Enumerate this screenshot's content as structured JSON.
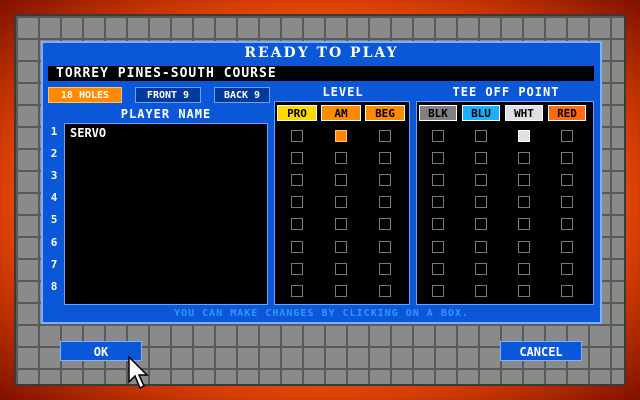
{
  "dialog": {
    "title": "READY TO PLAY",
    "course_name": "TORREY PINES-SOUTH COURSE",
    "hint": "YOU CAN MAKE CHANGES BY CLICKING ON A BOX."
  },
  "holes": {
    "options": [
      "18 HOLES",
      "FRONT 9",
      "BACK 9"
    ],
    "selected": "18 HOLES"
  },
  "player_column": {
    "label": "PLAYER NAME",
    "rows": [
      "1",
      "2",
      "3",
      "4",
      "5",
      "6",
      "7",
      "8"
    ],
    "players": [
      "SERVO",
      "",
      "",
      "",
      "",
      "",
      "",
      ""
    ]
  },
  "level": {
    "label": "LEVEL",
    "columns": [
      {
        "label": "PRO",
        "color": "#ffd800",
        "text_color": "#000000"
      },
      {
        "label": "AM",
        "color": "#ff8a00",
        "text_color": "#000000"
      },
      {
        "label": "BEG",
        "color": "#ff8a00",
        "text_color": "#000000"
      }
    ],
    "selection": [
      "AM",
      null,
      null,
      null,
      null,
      null,
      null,
      null
    ]
  },
  "tee": {
    "label": "TEE OFF POINT",
    "columns": [
      {
        "label": "BLK",
        "color": "#808080",
        "text_color": "#000000"
      },
      {
        "label": "BLU",
        "color": "#1ab0ff",
        "text_color": "#000000"
      },
      {
        "label": "WHT",
        "color": "#e0e0e0",
        "text_color": "#000000"
      },
      {
        "label": "RED",
        "color": "#ff6a10",
        "text_color": "#000000"
      }
    ],
    "selection": [
      "WHT",
      null,
      null,
      null,
      null,
      null,
      null,
      null
    ]
  },
  "buttons": {
    "ok": "OK",
    "cancel": "CANCEL"
  }
}
